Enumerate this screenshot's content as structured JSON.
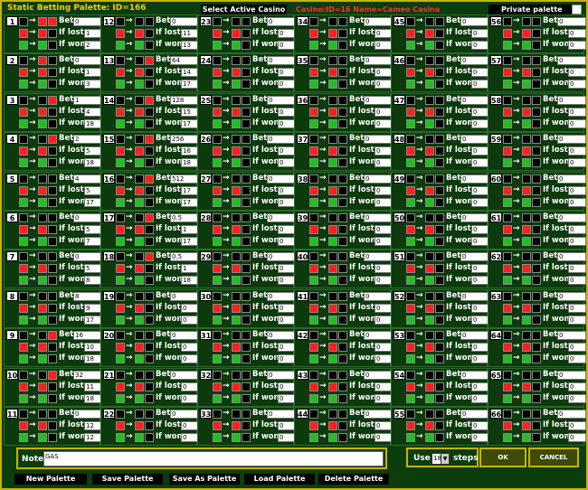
{
  "window": {
    "title": "Static Betting Palette: ID=166",
    "select_casino_label": "Select Active Casino",
    "casino_info": "Casino:ID=16 Name=Cameo Casino",
    "private_label": "Private palette"
  },
  "labels": {
    "bet": "Bet",
    "lost": "If lost->",
    "won": "If won->"
  },
  "cells": [
    {
      "num": "1",
      "top": "blk,red,red",
      "bet": "0",
      "lost": "1",
      "won": "2"
    },
    {
      "num": "2",
      "top": "blk,red,blk",
      "bet": "0",
      "lost": "1",
      "won": "3"
    },
    {
      "num": "3",
      "top": "blk,blk,red",
      "bet": "1",
      "lost": "4",
      "won": "18"
    },
    {
      "num": "4",
      "top": "blk,blk,red",
      "bet": "2",
      "lost": "5",
      "won": "18"
    },
    {
      "num": "5",
      "top": "blk,blk,blk",
      "bet": "4",
      "lost": "5",
      "won": "17"
    },
    {
      "num": "6",
      "top": "blk,blk,blk",
      "bet": "0",
      "lost": "5",
      "won": "7"
    },
    {
      "num": "7",
      "top": "blk,blk,blk",
      "bet": "0",
      "lost": "5",
      "won": "8"
    },
    {
      "num": "8",
      "top": "blk,blk,blk",
      "bet": "8",
      "lost": "9",
      "won": "17"
    },
    {
      "num": "9",
      "top": "blk,blk,red",
      "bet": "16",
      "lost": "10",
      "won": "18"
    },
    {
      "num": "10",
      "top": "blk,blk,red",
      "bet": "32",
      "lost": "11",
      "won": "18"
    },
    {
      "num": "11",
      "top": "blk,blk,blk",
      "bet": "0",
      "lost": "12",
      "won": "12"
    },
    {
      "num": "12",
      "top": "blk,blk,blk",
      "bet": "0",
      "lost": "11",
      "won": "13"
    },
    {
      "num": "13",
      "top": "blk,blk,red",
      "bet": "64",
      "lost": "14",
      "won": "17"
    },
    {
      "num": "14",
      "top": "blk,blk,red",
      "bet": "128",
      "lost": "15",
      "won": "17"
    },
    {
      "num": "15",
      "top": "blk,blk,red",
      "bet": "256",
      "lost": "16",
      "won": "18"
    },
    {
      "num": "16",
      "top": "blk,blk,red",
      "bet": "512",
      "lost": "17",
      "won": "17"
    },
    {
      "num": "17",
      "top": "blk,blk,red",
      "bet": "0.5",
      "lost": "1",
      "won": "17"
    },
    {
      "num": "18",
      "top": "blk,blk,red",
      "bet": "0.5",
      "lost": "1",
      "won": "18"
    },
    {
      "num": "19",
      "top": "blk,blk,blk",
      "bet": "0",
      "lost": "0",
      "won": "0"
    },
    {
      "num": "20",
      "top": "blk,blk,blk",
      "bet": "0",
      "lost": "0",
      "won": "0"
    },
    {
      "num": "21",
      "top": "blk,blk,blk",
      "bet": "0",
      "lost": "0",
      "won": "0"
    },
    {
      "num": "22",
      "top": "blk,blk,blk",
      "bet": "0",
      "lost": "0",
      "won": "0"
    },
    {
      "num": "23",
      "top": "blk,blk,blk",
      "bet": "0",
      "lost": "0",
      "won": "0"
    },
    {
      "num": "24",
      "top": "blk,blk,blk",
      "bet": "0",
      "lost": "0",
      "won": "0"
    },
    {
      "num": "25",
      "top": "blk,blk,blk",
      "bet": "0",
      "lost": "0",
      "won": "0"
    },
    {
      "num": "26",
      "top": "blk,blk,blk",
      "bet": "0",
      "lost": "0",
      "won": "0"
    },
    {
      "num": "27",
      "top": "blk,blk,blk",
      "bet": "0",
      "lost": "0",
      "won": "0"
    },
    {
      "num": "28",
      "top": "blk,blk,blk",
      "bet": "0",
      "lost": "0",
      "won": "0"
    },
    {
      "num": "29",
      "top": "blk,blk,blk",
      "bet": "0",
      "lost": "0",
      "won": "0"
    },
    {
      "num": "30",
      "top": "blk,blk,blk",
      "bet": "0",
      "lost": "0",
      "won": "0"
    },
    {
      "num": "31",
      "top": "blk,blk,blk",
      "bet": "0",
      "lost": "0",
      "won": "0"
    },
    {
      "num": "32",
      "top": "blk,blk,blk",
      "bet": "0",
      "lost": "0",
      "won": "0"
    },
    {
      "num": "33",
      "top": "blk,blk,blk",
      "bet": "0",
      "lost": "0",
      "won": "0"
    },
    {
      "num": "34",
      "top": "blk,blk,blk",
      "bet": "0",
      "lost": "0",
      "won": "0"
    },
    {
      "num": "35",
      "top": "blk,blk,blk",
      "bet": "0",
      "lost": "0",
      "won": "0"
    },
    {
      "num": "36",
      "top": "blk,blk,blk",
      "bet": "0",
      "lost": "0",
      "won": "0"
    },
    {
      "num": "37",
      "top": "blk,blk,blk",
      "bet": "0",
      "lost": "0",
      "won": "0"
    },
    {
      "num": "38",
      "top": "blk,blk,blk",
      "bet": "0",
      "lost": "0",
      "won": "0"
    },
    {
      "num": "39",
      "top": "blk,blk,blk",
      "bet": "0",
      "lost": "0",
      "won": "0"
    },
    {
      "num": "40",
      "top": "blk,blk,blk",
      "bet": "0",
      "lost": "0",
      "won": "0"
    },
    {
      "num": "41",
      "top": "blk,blk,blk",
      "bet": "0",
      "lost": "0",
      "won": "0"
    },
    {
      "num": "42",
      "top": "blk,blk,blk",
      "bet": "0",
      "lost": "0",
      "won": "0"
    },
    {
      "num": "43",
      "top": "blk,blk,blk",
      "bet": "0",
      "lost": "0",
      "won": "0"
    },
    {
      "num": "44",
      "top": "blk,blk,blk",
      "bet": "0",
      "lost": "0",
      "won": "0"
    },
    {
      "num": "45",
      "top": "blk,blk,blk",
      "bet": "0",
      "lost": "0",
      "won": "0"
    },
    {
      "num": "46",
      "top": "blk,blk,blk",
      "bet": "0",
      "lost": "0",
      "won": "0"
    },
    {
      "num": "47",
      "top": "blk,blk,blk",
      "bet": "0",
      "lost": "0",
      "won": "0"
    },
    {
      "num": "48",
      "top": "blk,blk,blk",
      "bet": "0",
      "lost": "0",
      "won": "0"
    },
    {
      "num": "49",
      "top": "blk,blk,blk",
      "bet": "0",
      "lost": "0",
      "won": "0"
    },
    {
      "num": "50",
      "top": "blk,blk,blk",
      "bet": "0",
      "lost": "0",
      "won": "0"
    },
    {
      "num": "51",
      "top": "blk,blk,blk",
      "bet": "0",
      "lost": "0",
      "won": "0"
    },
    {
      "num": "52",
      "top": "blk,blk,blk",
      "bet": "0",
      "lost": "0",
      "won": "0"
    },
    {
      "num": "53",
      "top": "blk,blk,blk",
      "bet": "0",
      "lost": "0",
      "won": "0"
    },
    {
      "num": "54",
      "top": "blk,blk,blk",
      "bet": "0",
      "lost": "0",
      "won": "0"
    },
    {
      "num": "55",
      "top": "blk,blk,blk",
      "bet": "0",
      "lost": "0",
      "won": "0"
    },
    {
      "num": "56",
      "top": "blk,blk,blk",
      "bet": "0",
      "lost": "0",
      "won": "0"
    },
    {
      "num": "57",
      "top": "blk,blk,blk",
      "bet": "0",
      "lost": "0",
      "won": "0"
    },
    {
      "num": "58",
      "top": "blk,blk,blk",
      "bet": "0",
      "lost": "0",
      "won": "0"
    },
    {
      "num": "59",
      "top": "blk,blk,blk",
      "bet": "0",
      "lost": "0",
      "won": "0"
    },
    {
      "num": "60",
      "top": "blk,blk,blk",
      "bet": "0",
      "lost": "0",
      "won": "0"
    },
    {
      "num": "61",
      "top": "blk,blk,blk",
      "bet": "0",
      "lost": "0",
      "won": "0"
    },
    {
      "num": "62",
      "top": "blk,blk,blk",
      "bet": "0",
      "lost": "0",
      "won": "0"
    },
    {
      "num": "63",
      "top": "blk,blk,blk",
      "bet": "0",
      "lost": "0",
      "won": "0"
    },
    {
      "num": "64",
      "top": "blk,blk,blk",
      "bet": "0",
      "lost": "0",
      "won": "0"
    },
    {
      "num": "65",
      "top": "blk,blk,blk",
      "bet": "0",
      "lost": "0",
      "won": "0"
    },
    {
      "num": "66",
      "top": "blk,blk,blk",
      "bet": "0",
      "lost": "0",
      "won": "0"
    }
  ],
  "note": {
    "label": "Note:",
    "value": "GAS"
  },
  "use": {
    "label": "Use",
    "value": "18",
    "steps": "steps"
  },
  "dialog_buttons": {
    "ok": "OK",
    "cancel": "CANCEL"
  },
  "footer": [
    "New Palette",
    "Save Palette",
    "Save As Palette",
    "Load Palette",
    "Delete Palette"
  ],
  "colors": {
    "accent": "#c8b400",
    "background": "#0c3d0c",
    "red": "#ff2020",
    "green": "#20c020"
  }
}
